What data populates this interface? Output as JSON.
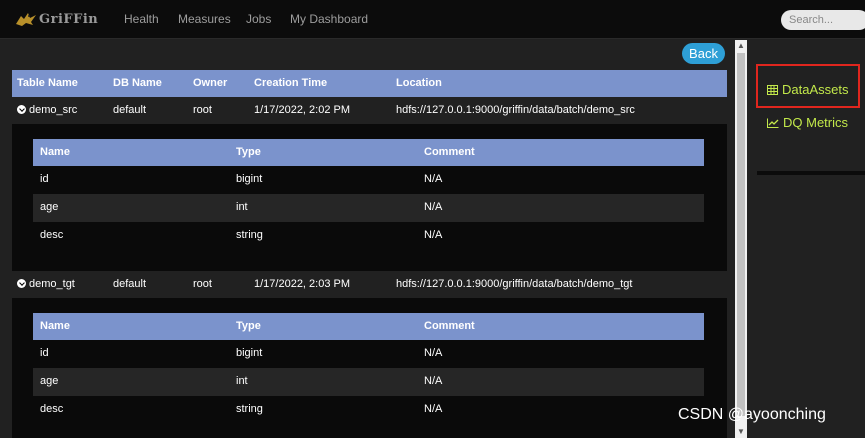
{
  "app": {
    "logo_text": "GriFFin"
  },
  "nav": {
    "items": [
      {
        "label": "Health"
      },
      {
        "label": "Measures"
      },
      {
        "label": "Jobs"
      },
      {
        "label": "My Dashboard"
      }
    ]
  },
  "search": {
    "placeholder": "Search..."
  },
  "back_label": "Back",
  "table": {
    "headers": [
      "Table Name",
      "DB Name",
      "Owner",
      "Creation Time",
      "Location"
    ],
    "rows": [
      {
        "name": "demo_src",
        "db": "default",
        "owner": "root",
        "time": "1/17/2022, 2:02 PM",
        "location": "hdfs://127.0.0.1:9000/griffin/data/batch/demo_src"
      },
      {
        "name": "demo_tgt",
        "db": "default",
        "owner": "root",
        "time": "1/17/2022, 2:03 PM",
        "location": "hdfs://127.0.0.1:9000/griffin/data/batch/demo_tgt"
      }
    ]
  },
  "details": [
    {
      "headers": [
        "Name",
        "Type",
        "Comment"
      ],
      "rows": [
        [
          "id",
          "bigint",
          "N/A"
        ],
        [
          "age",
          "int",
          "N/A"
        ],
        [
          "desc",
          "string",
          "N/A"
        ]
      ]
    },
    {
      "headers": [
        "Name",
        "Type",
        "Comment"
      ],
      "rows": [
        [
          "id",
          "bigint",
          "N/A"
        ],
        [
          "age",
          "int",
          "N/A"
        ],
        [
          "desc",
          "string",
          "N/A"
        ]
      ]
    }
  ],
  "sidebar": {
    "items": [
      {
        "label": "DataAssets",
        "icon": "table-icon"
      },
      {
        "label": "DQ Metrics",
        "icon": "line-chart-icon"
      }
    ]
  },
  "watermark": "CSDN @ayoonching",
  "colors": {
    "accent": "#c2e84a",
    "header_blue": "#7b93cc",
    "back_button": "#2e9fd6",
    "highlight": "#e0261e"
  }
}
